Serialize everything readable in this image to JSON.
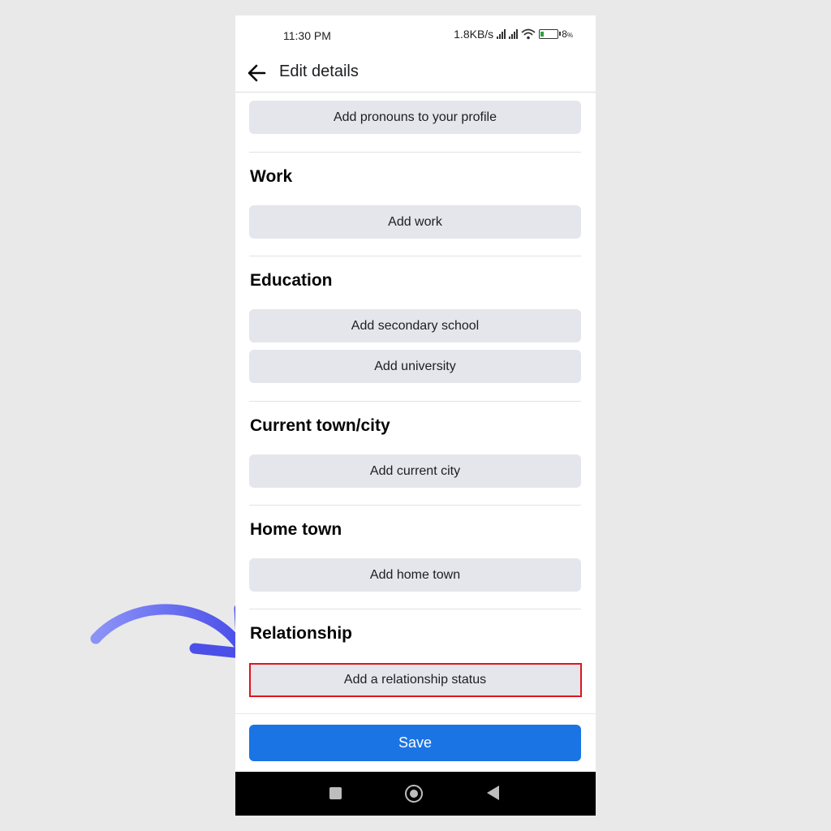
{
  "status_bar": {
    "time": "11:30 PM",
    "network_speed": "1.8KB/s",
    "battery_level": "8",
    "battery_unit": "%"
  },
  "app_bar": {
    "title": "Edit details"
  },
  "pronouns": {
    "button_label": "Add pronouns to your profile"
  },
  "sections": {
    "work": {
      "title": "Work",
      "button_label": "Add work"
    },
    "education": {
      "title": "Education",
      "secondary_label": "Add secondary school",
      "university_label": "Add university"
    },
    "current_town": {
      "title": "Current town/city",
      "button_label": "Add current city"
    },
    "home_town": {
      "title": "Home town",
      "button_label": "Add home town"
    },
    "relationship": {
      "title": "Relationship",
      "button_label": "Add a relationship status"
    }
  },
  "footer": {
    "save_label": "Save"
  },
  "colors": {
    "primary": "#1b74e4",
    "highlight": "#e0141e",
    "arrow": "#5a63f0"
  },
  "icons": [
    "back-arrow-icon",
    "signal-icon",
    "wifi-icon",
    "battery-icon",
    "nav-recents-icon",
    "nav-home-icon",
    "nav-back-icon"
  ]
}
